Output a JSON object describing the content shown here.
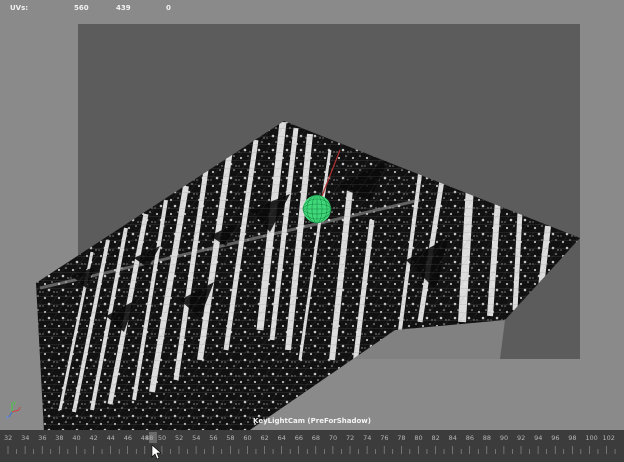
{
  "hud": {
    "label": "UVs:",
    "values": [
      "560",
      "439",
      "0"
    ]
  },
  "camera_label": "KeyLightCam (PreForShadow)",
  "axis": {
    "x": "x",
    "y": "y",
    "z": "z"
  },
  "timeline": {
    "ticks": [
      "32",
      "34",
      "36",
      "38",
      "40",
      "42",
      "44",
      "46",
      "48",
      "50",
      "52",
      "54",
      "56",
      "58",
      "60",
      "62",
      "64",
      "66",
      "68",
      "70",
      "72",
      "74",
      "76",
      "78",
      "80",
      "82",
      "84",
      "86",
      "88",
      "90",
      "92",
      "94",
      "96",
      "98",
      "100",
      "102"
    ],
    "current_frame": "48"
  },
  "colors": {
    "viewport_bg": "#8a8a8a",
    "resolution_gate": "#5c5c5c",
    "timeline_bg": "#3c3c3c",
    "selection_sphere": "#3fd97a"
  },
  "icons": {
    "scene": "textured-plane-shadow-preview",
    "sphere": "wireframe-sphere-icon",
    "axis": "view-axis-icon",
    "playhead": "timeline-playhead-icon"
  }
}
